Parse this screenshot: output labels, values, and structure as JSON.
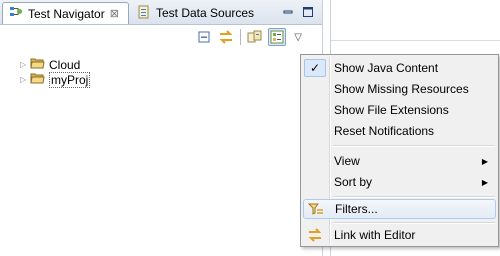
{
  "tabs": [
    {
      "label": "Test Navigator",
      "close": "⊠"
    },
    {
      "label": "Test Data Sources"
    }
  ],
  "tree": [
    {
      "label": "Cloud"
    },
    {
      "label": "myProj"
    }
  ],
  "menu": {
    "items": [
      {
        "label": "Show Java Content",
        "checked": true
      },
      {
        "label": "Show Missing Resources"
      },
      {
        "label": "Show File Extensions"
      },
      {
        "label": "Reset Notifications"
      },
      {
        "label": "View",
        "submenu": true
      },
      {
        "label": "Sort by",
        "submenu": true
      },
      {
        "label": "Filters..."
      },
      {
        "label": "Link with Editor"
      }
    ],
    "checkmark": "✓",
    "arrow": "▶"
  },
  "colors": {
    "accent": "#2f6fb5",
    "folder": "#d9b65a",
    "link_icon": "#e0a020"
  }
}
